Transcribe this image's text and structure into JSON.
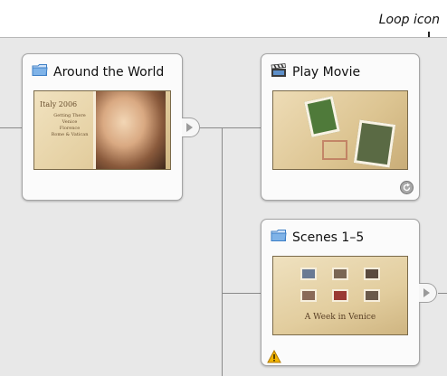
{
  "callout": {
    "text": "Loop icon"
  },
  "nodes": [
    {
      "title": "Around the World",
      "icon": "folder-icon",
      "thumb_lines": [
        "Italy 2006",
        "Getting There",
        "Venice",
        "Florence",
        "Rome & Vatican"
      ]
    },
    {
      "title": "Play Movie",
      "icon": "clapperboard-icon",
      "badge": "loop-icon"
    },
    {
      "title": "Scenes 1–5",
      "icon": "folder-icon",
      "badge": "warning-icon",
      "thumb_caption": "A Week in Venice"
    }
  ],
  "colors": {
    "folder": "#7fb3e8",
    "warning": "#f2b400",
    "canvas": "#e8e8e8"
  }
}
